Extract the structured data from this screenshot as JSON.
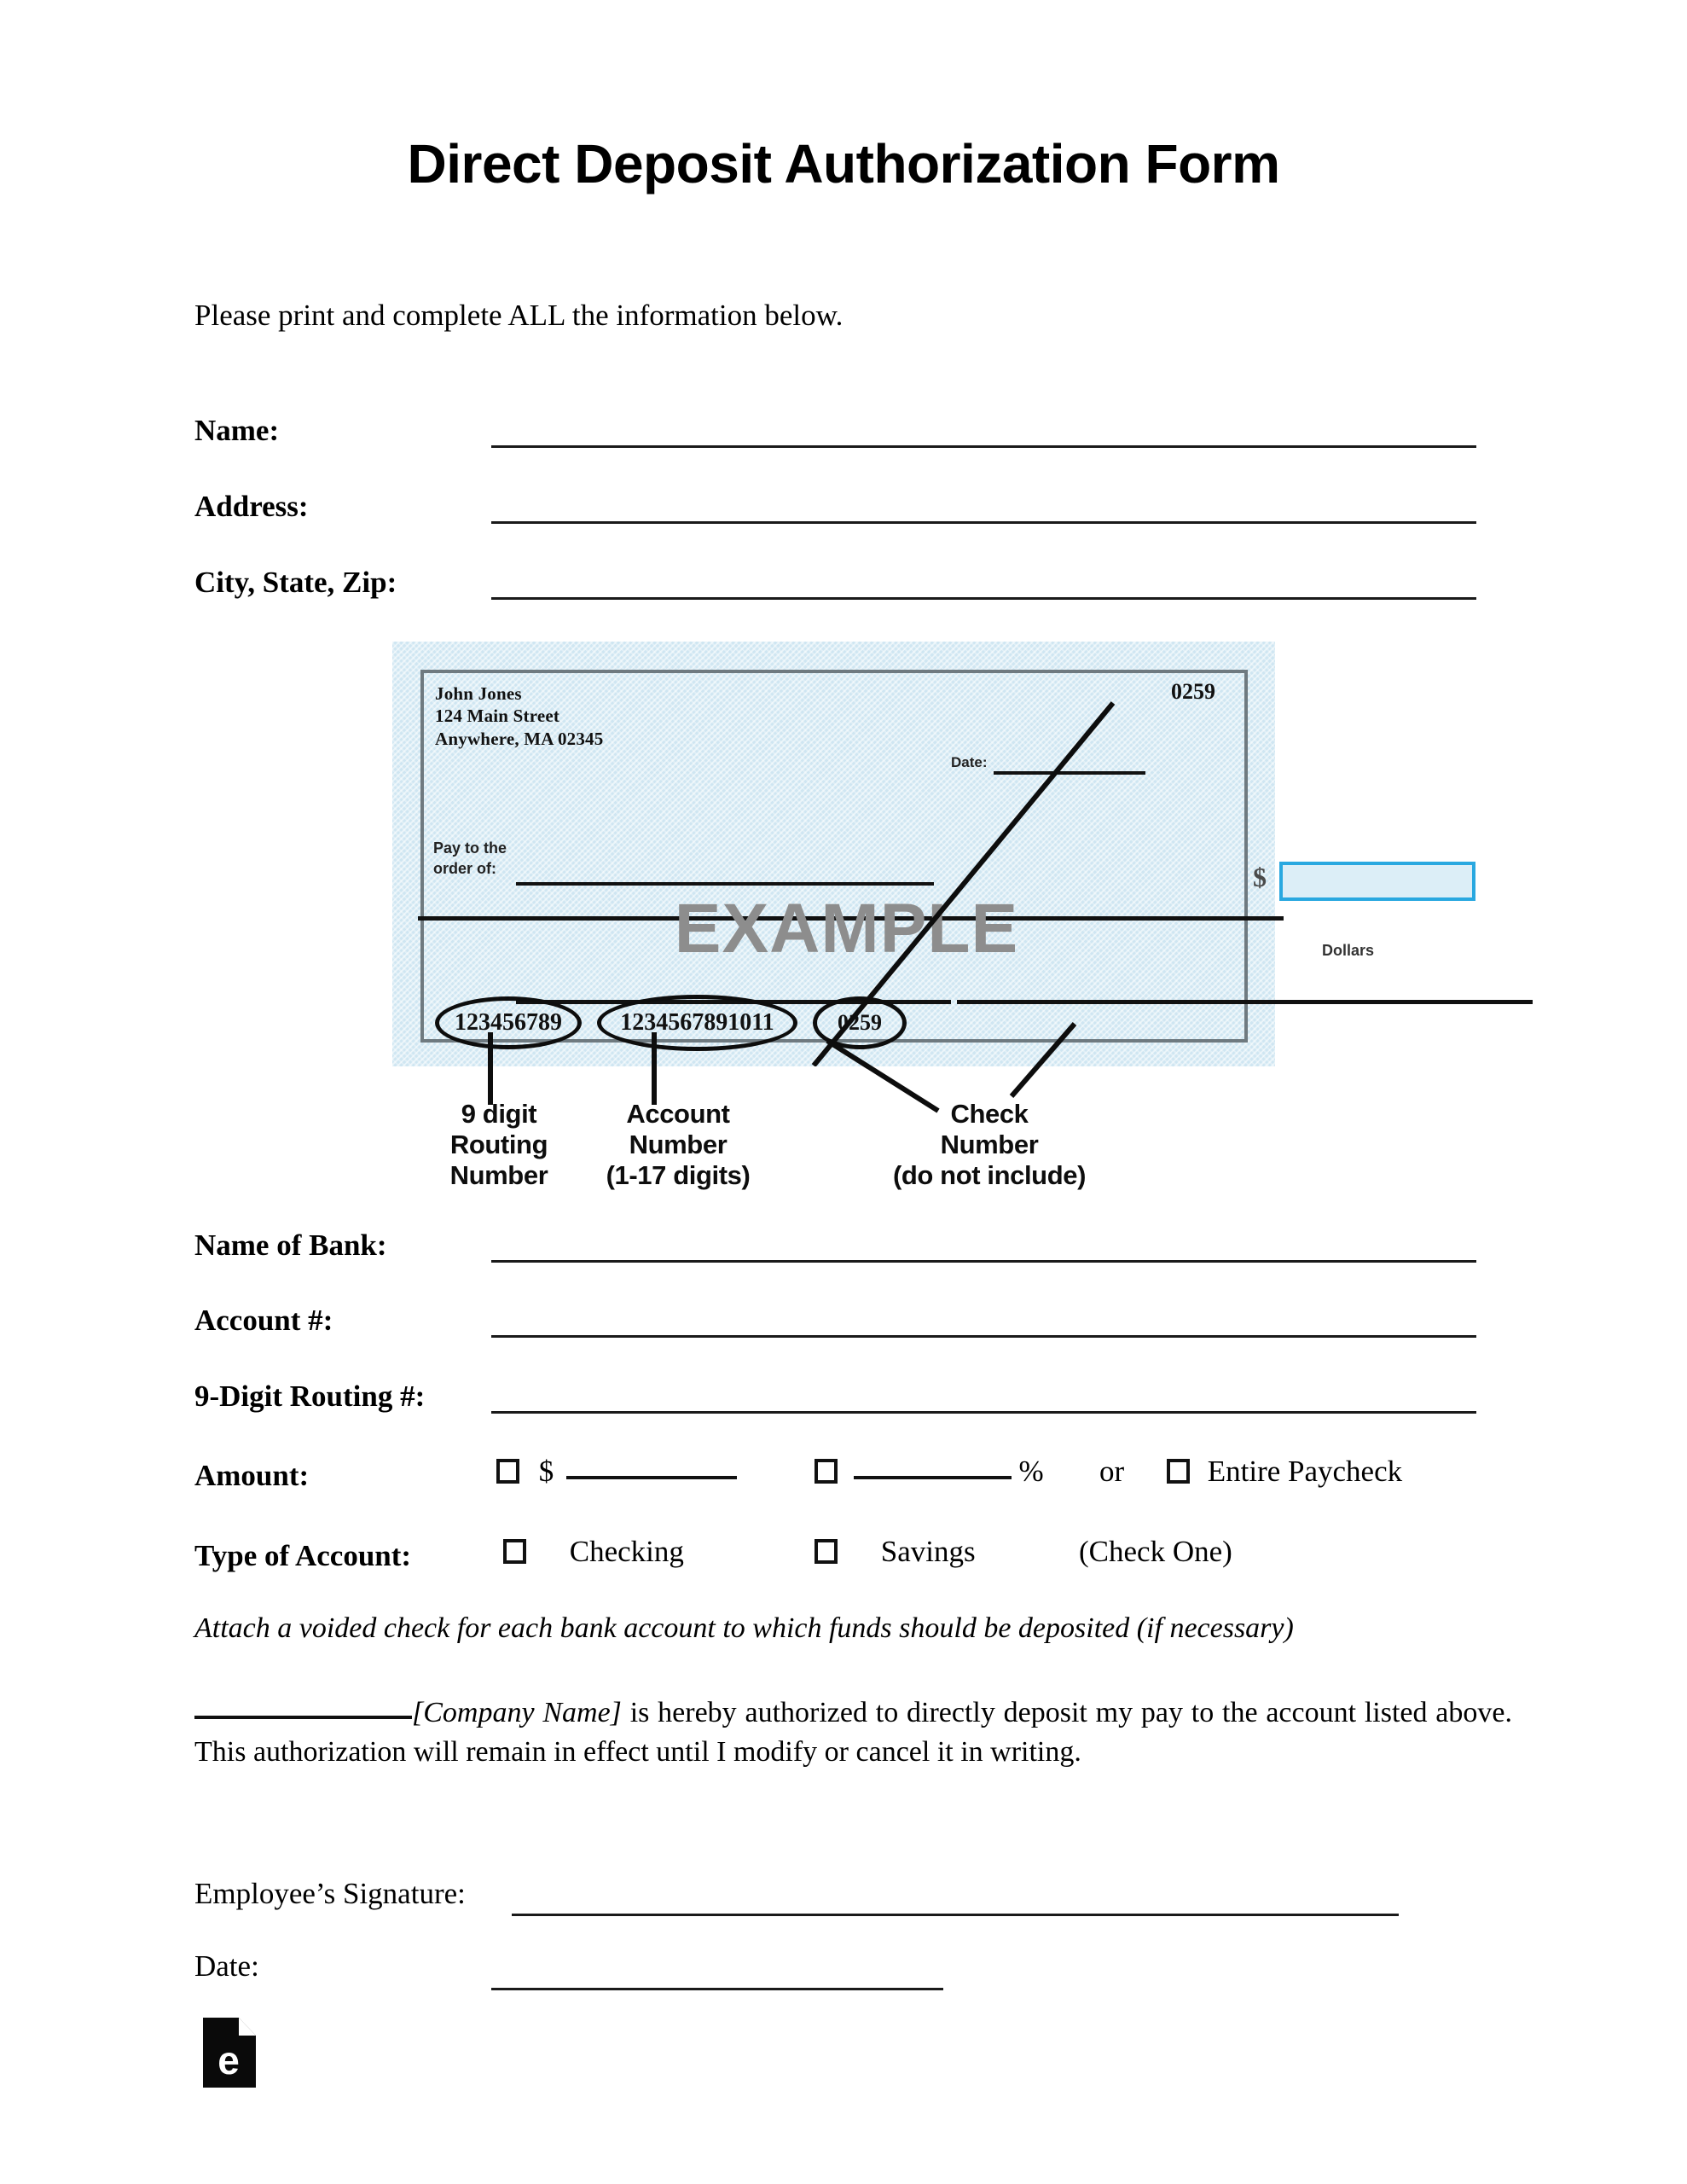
{
  "document": {
    "title": "Direct Deposit Authorization Form",
    "intro": "Please print and complete ALL the information below."
  },
  "fields": {
    "name": {
      "label": "Name",
      "colon": ":"
    },
    "address": {
      "label": "Address",
      "colon": ":"
    },
    "city_state_zip": {
      "label": "City, State, Zip",
      "colon": ":"
    },
    "bank_name": {
      "label": "Name of Bank",
      "colon": ":"
    },
    "account_number": {
      "label": "Account #",
      "colon": ":"
    },
    "routing_number": {
      "label": "9-Digit Routing #",
      "colon": ":"
    },
    "amount": {
      "label": "Amount",
      "colon": ":"
    },
    "account_type": {
      "label": "Type of Account",
      "colon": ":"
    }
  },
  "amount_row": {
    "dollar_sign": "$",
    "percent_sign": "%",
    "or": "or",
    "entire_paycheck": "Entire Paycheck"
  },
  "account_type_row": {
    "checking": "Checking",
    "savings": "Savings",
    "hint": "(Check One)"
  },
  "check_image": {
    "payer_name": "John Jones",
    "payer_street": "124 Main Street",
    "payer_city": "Anywhere, MA 02345",
    "check_number_top": "0259",
    "date_label": "Date:",
    "pay_to_line1": "Pay to the",
    "pay_to_line2": "order of:",
    "amount_symbol": "$",
    "dollars_label": "Dollars",
    "watermark": "EXAMPLE",
    "micr_routing": "123456789",
    "micr_account": "1234567891011",
    "micr_check": "0259",
    "callouts": {
      "routing": "9 digit\nRouting\nNumber",
      "routing_lines": [
        "9 digit",
        "Routing",
        "Number"
      ],
      "account_lines": [
        "Account",
        "Number",
        "(1-17 digits)"
      ],
      "check_lines": [
        "Check",
        "Number",
        "(do not include)"
      ]
    },
    "colors": {
      "check_background": "#cfe6f2",
      "check_border": "#6f7a80",
      "amount_box_border": "#29a8e0",
      "watermark_color": "#8d8d8d"
    }
  },
  "notes": {
    "voided_check": "Attach a voided check for each bank account to which funds should be deposited (if necessary)",
    "authorization_company": "[Company Name]",
    "authorization_text": " is hereby authorized to directly deposit my pay to the account listed above. This authorization will remain in effect until I modify or cancel it in writing."
  },
  "footer": {
    "signature_label": "Employee’s Signature:",
    "date_label": "Date:",
    "logo_letter": "e"
  }
}
